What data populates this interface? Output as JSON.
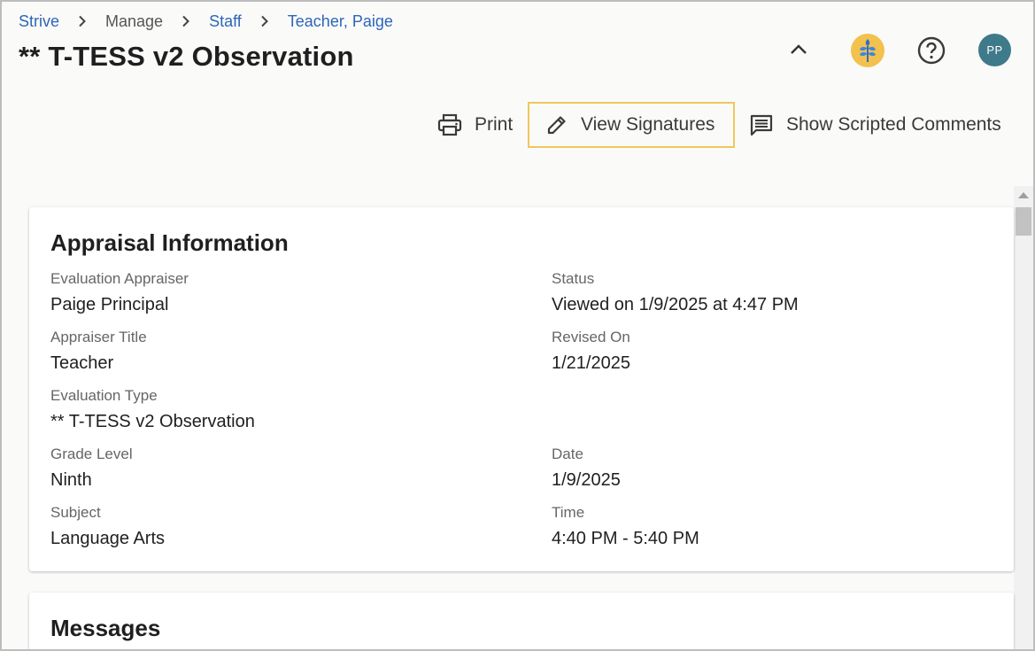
{
  "breadcrumb": {
    "items": [
      {
        "label": "Strive",
        "link": true
      },
      {
        "label": "Manage",
        "link": false
      },
      {
        "label": "Staff",
        "link": true
      },
      {
        "label": "Teacher, Paige",
        "link": true
      }
    ]
  },
  "page": {
    "title": "** T-TESS v2 Observation"
  },
  "header": {
    "avatar_initials": "PP",
    "icons": [
      "chevron-up-icon",
      "wheat-logo-icon",
      "help-circle-icon"
    ]
  },
  "actions": {
    "print_label": "Print",
    "signatures_label": "View Signatures",
    "comments_label": "Show Scripted Comments"
  },
  "appraisal": {
    "title": "Appraisal Information",
    "fields": {
      "appraiser": {
        "label": "Evaluation Appraiser",
        "value": "Paige Principal"
      },
      "appraiser_title": {
        "label": "Appraiser Title",
        "value": "Teacher"
      },
      "eval_type": {
        "label": "Evaluation Type",
        "value": "** T-TESS v2 Observation"
      },
      "grade": {
        "label": "Grade Level",
        "value": "Ninth"
      },
      "subject": {
        "label": "Subject",
        "value": "Language Arts"
      },
      "status": {
        "label": "Status",
        "value": "Viewed on 1/9/2025 at 4:47 PM"
      },
      "revised": {
        "label": "Revised On",
        "value": "1/21/2025"
      },
      "date": {
        "label": "Date",
        "value": "1/9/2025"
      },
      "time": {
        "label": "Time",
        "value": "4:40 PM - 5:40 PM"
      }
    }
  },
  "messages": {
    "title": "Messages"
  },
  "colors": {
    "link": "#2c66b8",
    "highlight_border": "#f0c75e",
    "avatar_bg": "#3f7a8a",
    "logo_bg": "#f2c14e"
  }
}
